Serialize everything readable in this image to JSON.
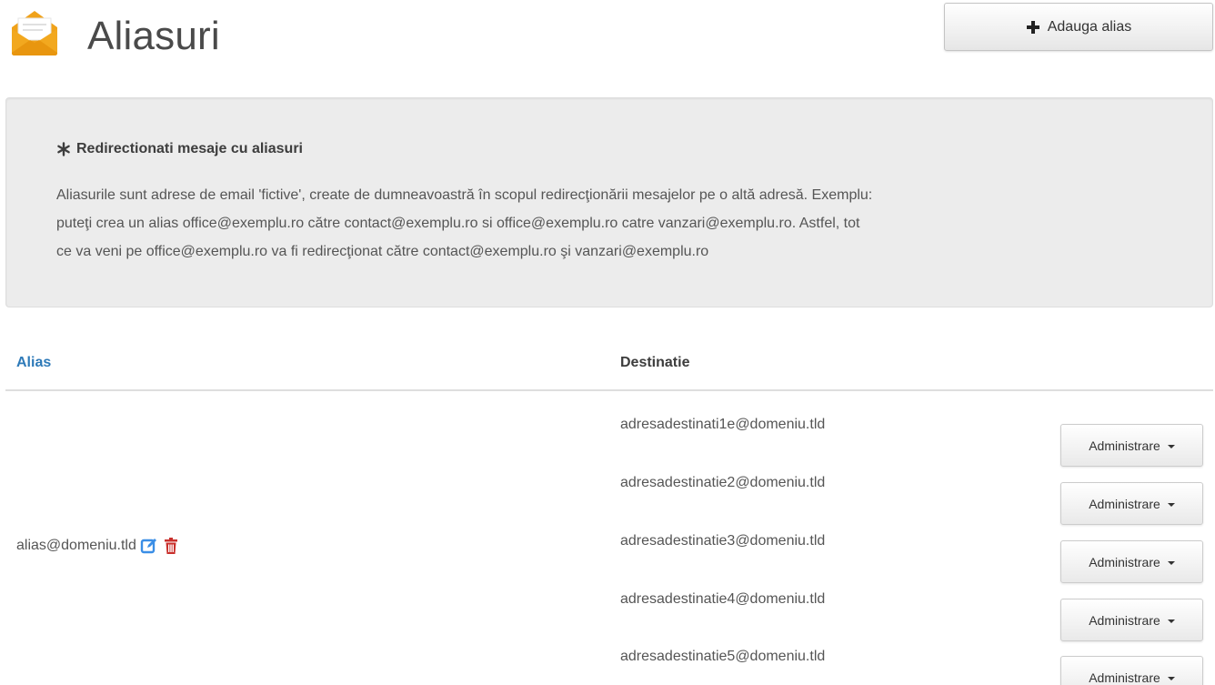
{
  "header": {
    "title": "Aliasuri",
    "icon": "envelope-icon",
    "add_button": {
      "label": "Adauga alias",
      "icon": "plus-icon"
    }
  },
  "info": {
    "heading": "Redirectionati mesaje cu aliasuri",
    "heading_icon": "asterisk-icon",
    "lines": [
      "Aliasurile sunt adrese de email 'fictive', create de dumneavoastră în scopul redirecţionării mesajelor pe o altă adresă. Exemplu:",
      "puteţi crea un alias office@exemplu.ro către contact@exemplu.ro si office@exemplu.ro catre vanzari@exemplu.ro. Astfel, tot",
      "ce va veni pe office@exemplu.ro va fi redirecţionat către contact@exemplu.ro şi vanzari@exemplu.ro"
    ]
  },
  "table": {
    "columns": {
      "alias": "Alias",
      "destination": "Destinatie"
    },
    "alias": {
      "value": "alias@domeniu.tld",
      "edit_icon": "edit-icon",
      "delete_icon": "trash-icon"
    },
    "destinations": [
      {
        "email": "adresadestinati1e@domeniu.tld",
        "action": "Administrare"
      },
      {
        "email": "adresadestinatie2@domeniu.tld",
        "action": "Administrare"
      },
      {
        "email": "adresadestinatie3@domeniu.tld",
        "action": "Administrare"
      },
      {
        "email": "adresadestinatie4@domeniu.tld",
        "action": "Administrare"
      },
      {
        "email": "adresadestinatie5@domeniu.tld",
        "action": "Administrare"
      }
    ]
  },
  "colors": {
    "accent_orange": "#f0a21a",
    "link_blue": "#2e7ab8",
    "edit_blue": "#3a8ee6",
    "delete_red": "#c9302c",
    "well_background": "#ececec"
  }
}
